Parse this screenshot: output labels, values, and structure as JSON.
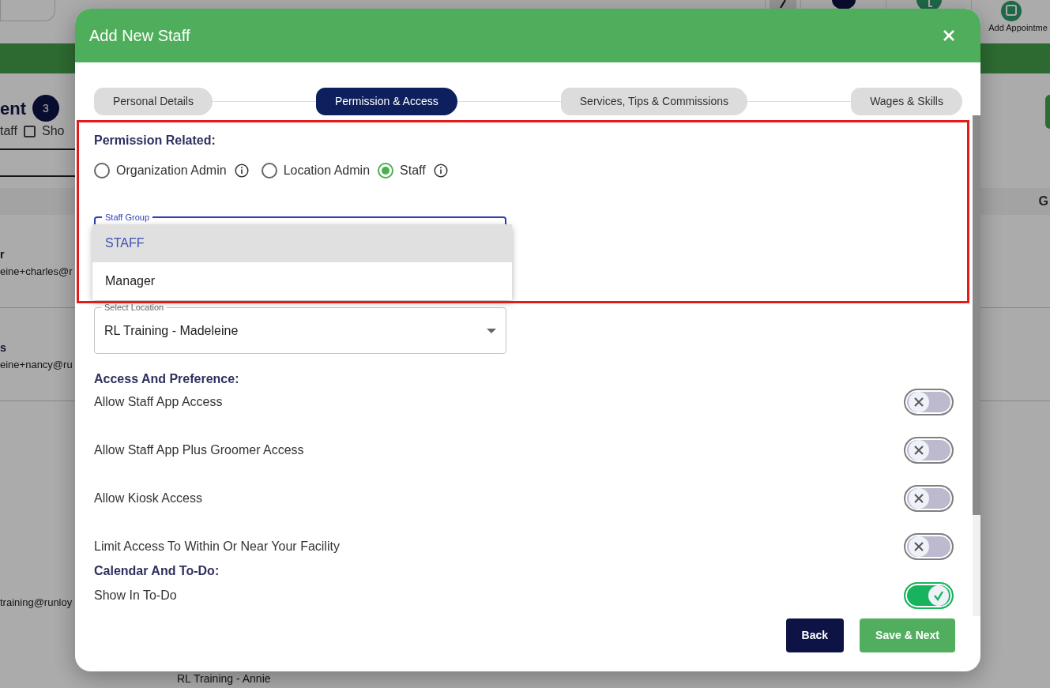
{
  "background": {
    "toolbar_label": "Add Appointme",
    "heading_fragment": "ent",
    "count": "3",
    "filter_fragment": "taff",
    "show_label": "Sho",
    "show_checked": false,
    "column_fragment": "G",
    "rows": [
      {
        "name": "r",
        "email": "eine+charles@r"
      },
      {
        "name": "s",
        "email": "eine+nancy@ru"
      },
      {
        "email": "training@runloy"
      }
    ],
    "location_fragment": "RL Training - Annie"
  },
  "modal": {
    "title": "Add New Staff",
    "tabs": [
      {
        "label": "Personal Details",
        "selected": false
      },
      {
        "label": "Permission & Access",
        "selected": true
      },
      {
        "label": "Services, Tips & Commissions",
        "selected": false
      },
      {
        "label": "Wages & Skills",
        "selected": false
      }
    ],
    "permission": {
      "heading": "Permission Related:",
      "options": [
        {
          "label": "Organization Admin",
          "selected": false,
          "info": true
        },
        {
          "label": "Location Admin",
          "selected": false,
          "info": false
        },
        {
          "label": "Staff",
          "selected": true,
          "info": true
        }
      ]
    },
    "staff_group": {
      "label": "Staff Group",
      "options": [
        {
          "label": "STAFF",
          "selected": true
        },
        {
          "label": "Manager",
          "selected": false
        }
      ]
    },
    "location": {
      "label": "Select Location",
      "value": "RL Training - Madeleine"
    },
    "sections": [
      {
        "heading": "Access And Preference:",
        "toggles": [
          {
            "label": "Allow Staff App Access",
            "on": false
          },
          {
            "label": "Allow Staff App Plus Groomer Access",
            "on": false
          },
          {
            "label": "Allow Kiosk Access",
            "on": false
          },
          {
            "label": "Limit Access To Within Or Near Your Facility",
            "on": false
          }
        ]
      },
      {
        "heading": "Calendar And To-Do:",
        "toggles": [
          {
            "label": "Show In To-Do",
            "on": true
          }
        ]
      }
    ],
    "buttons": [
      {
        "label": "Back",
        "kind": "secondary"
      },
      {
        "label": "Save & Next",
        "kind": "primary"
      }
    ]
  }
}
